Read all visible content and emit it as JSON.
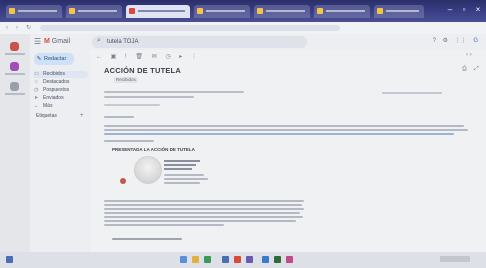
{
  "colors": {
    "browser_tabbar": "#3a3f86",
    "gmail_red": "#d94a3a",
    "compose_bg": "#cfe1f7",
    "selected_nav_bg": "#dfe6f2",
    "signature_red": "#c8574a"
  },
  "gmail": {
    "logo_text": "Gmail",
    "search_query": "tutela TOJA",
    "compose_label": "Redactar"
  },
  "sidebar": {
    "items": [
      {
        "label": "Recibidos",
        "icon": "inbox-icon",
        "selected": true
      },
      {
        "label": "Destacados",
        "icon": "star-icon",
        "selected": false
      },
      {
        "label": "Pospuestos",
        "icon": "clock-icon",
        "selected": false
      },
      {
        "label": "Enviados",
        "icon": "send-icon",
        "selected": false
      },
      {
        "label": "Más",
        "icon": "chevron-down-icon",
        "selected": false
      }
    ],
    "labels_heading": "Etiquetas"
  },
  "message": {
    "subject": "ACCIÓN DE TUTELA",
    "label_chip": "Recibidos",
    "section_heading": "PRESENTADA LA ACCIÓN DE TUTELA"
  }
}
